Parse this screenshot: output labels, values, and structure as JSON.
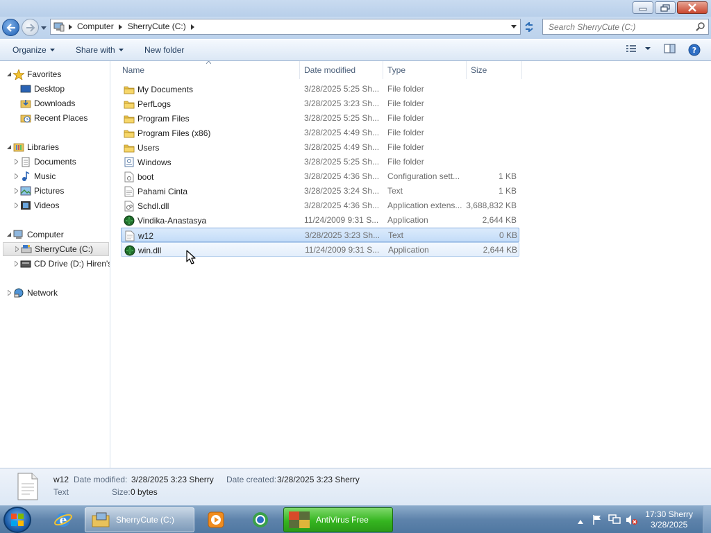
{
  "window": {
    "address_crumbs": [
      "Computer",
      "SherryCute (C:)"
    ],
    "search_placeholder": "Search SherryCute (C:)"
  },
  "toolbar": {
    "organize": "Organize",
    "share_with": "Share with",
    "new_folder": "New folder"
  },
  "nav": {
    "favorites": "Favorites",
    "desktop": "Desktop",
    "downloads": "Downloads",
    "recent_places": "Recent Places",
    "libraries": "Libraries",
    "documents": "Documents",
    "music": "Music",
    "pictures": "Pictures",
    "videos": "Videos",
    "computer": "Computer",
    "drive_c": "SherryCute (C:)",
    "drive_d": "CD Drive (D:) Hiren's",
    "network": "Network"
  },
  "columns": {
    "name": "Name",
    "date": "Date modified",
    "type": "Type",
    "size": "Size"
  },
  "files": [
    {
      "name": "My Documents",
      "date": "3/28/2025 5:25 Sh...",
      "type": "File folder",
      "size": "",
      "icon": "folder-icon"
    },
    {
      "name": "PerfLogs",
      "date": "3/28/2025 3:23 Sh...",
      "type": "File folder",
      "size": "",
      "icon": "folder-icon"
    },
    {
      "name": "Program Files",
      "date": "3/28/2025 5:25 Sh...",
      "type": "File folder",
      "size": "",
      "icon": "folder-icon"
    },
    {
      "name": "Program Files (x86)",
      "date": "3/28/2025 4:49 Sh...",
      "type": "File folder",
      "size": "",
      "icon": "folder-icon"
    },
    {
      "name": "Users",
      "date": "3/28/2025 4:49 Sh...",
      "type": "File folder",
      "size": "",
      "icon": "folder-icon"
    },
    {
      "name": "Windows",
      "date": "3/28/2025 5:25 Sh...",
      "type": "File folder",
      "size": "",
      "icon": "system-folder-icon"
    },
    {
      "name": "boot",
      "date": "3/28/2025 4:36 Sh...",
      "type": "Configuration sett...",
      "size": "1 KB",
      "icon": "config-file-icon"
    },
    {
      "name": "Pahami Cinta",
      "date": "3/28/2025 3:24 Sh...",
      "type": "Text",
      "size": "1 KB",
      "icon": "text-file-icon"
    },
    {
      "name": "Schdl.dll",
      "date": "3/28/2025 4:36 Sh...",
      "type": "Application extens...",
      "size": "3,688,832 KB",
      "icon": "dll-file-icon"
    },
    {
      "name": "Vindika-Anastasya",
      "date": "11/24/2009 9:31 S...",
      "type": "Application",
      "size": "2,644 KB",
      "icon": "green-app-icon"
    },
    {
      "name": "w12",
      "date": "3/28/2025 3:23 Sh...",
      "type": "Text",
      "size": "0 KB",
      "icon": "text-file-icon"
    },
    {
      "name": "win.dll",
      "date": "11/24/2009 9:31 S...",
      "type": "Application",
      "size": "2,644 KB",
      "icon": "green-app-icon"
    }
  ],
  "details": {
    "name": "w12",
    "type": "Text",
    "date_modified_label": "Date modified:",
    "date_modified": "3/28/2025 3:23 Sherry",
    "date_created_label": "Date created:",
    "date_created": "3/28/2025 3:23 Sherry",
    "size_label": "Size:",
    "size": "0 bytes"
  },
  "taskbar": {
    "explorer_label": "SherryCute (C:)",
    "antivirus_label": "AntiVirus Free",
    "clock_time": "17:30 Sherry",
    "clock_date": "3/28/2025"
  },
  "colors": {
    "selection": "#cce4fa",
    "taskbar": "#5e83ab",
    "antivirus": "#35b520"
  }
}
